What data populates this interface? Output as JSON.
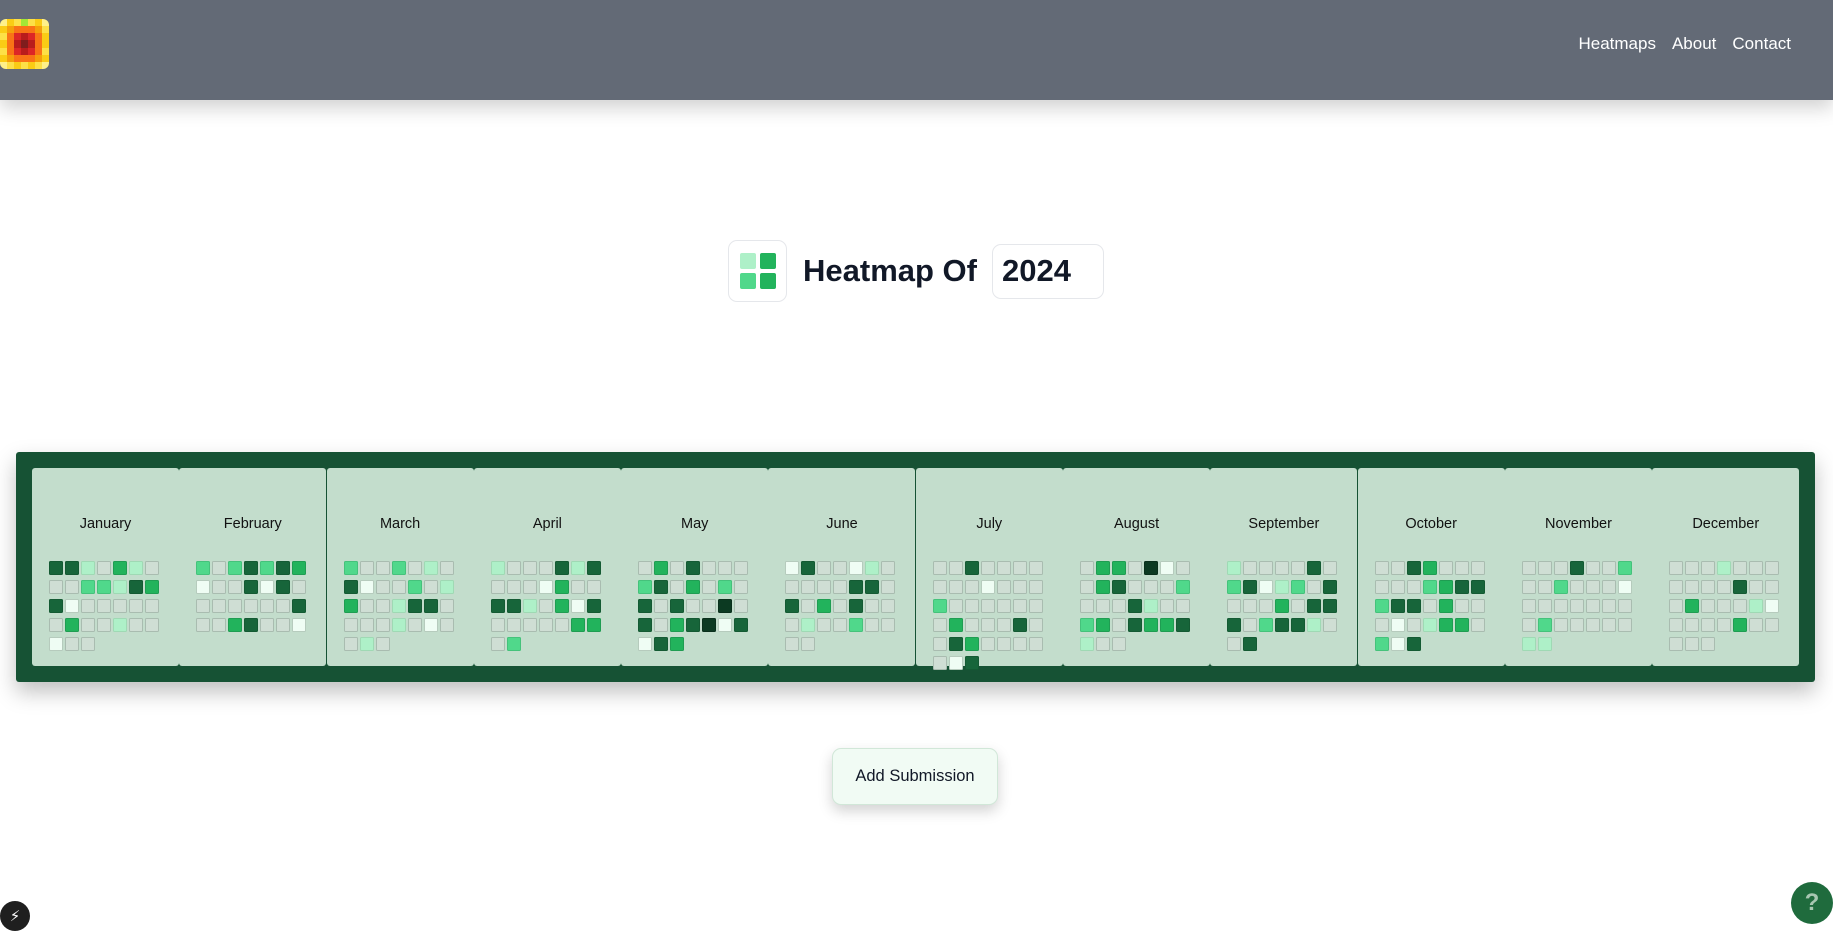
{
  "nav": {
    "logo_alt": "heatmap-logo",
    "links": [
      "Heatmaps",
      "About",
      "Contact"
    ]
  },
  "title": {
    "text": "Heatmap Of",
    "year": "2024"
  },
  "palette": [
    "#cfded4",
    "#effdf4",
    "#aef0c8",
    "#50d88b",
    "#22b35c",
    "#17653a",
    "#0c3a22"
  ],
  "logo_colors": {
    "grid": [
      [
        "#fef08a",
        "#facc15",
        "#fde047",
        "#a3e635",
        "#fde047",
        "#facc15",
        "#fef08a"
      ],
      [
        "#facc15",
        "#f59e0b",
        "#f97316",
        "#f97316",
        "#f97316",
        "#f59e0b",
        "#fde047"
      ],
      [
        "#fde047",
        "#f97316",
        "#dc2626",
        "#b91c1c",
        "#dc2626",
        "#f97316",
        "#facc15"
      ],
      [
        "#facc15",
        "#f97316",
        "#b91c1c",
        "#7f1d1d",
        "#b91c1c",
        "#f97316",
        "#facc15"
      ],
      [
        "#fde047",
        "#f97316",
        "#dc2626",
        "#b91c1c",
        "#dc2626",
        "#f97316",
        "#fde047"
      ],
      [
        "#facc15",
        "#f59e0b",
        "#f97316",
        "#f97316",
        "#f97316",
        "#f59e0b",
        "#facc15"
      ],
      [
        "#fef08a",
        "#fde047",
        "#facc15",
        "#fde047",
        "#facc15",
        "#fde047",
        "#fef08a"
      ]
    ]
  },
  "months": [
    {
      "name": "January",
      "offset": 0,
      "levels": [
        5,
        5,
        2,
        0,
        4,
        2,
        0,
        0,
        0,
        3,
        3,
        2,
        5,
        4,
        5,
        1,
        0,
        0,
        0,
        0,
        0,
        0,
        4,
        0,
        0,
        2,
        0,
        0,
        1,
        0,
        0
      ]
    },
    {
      "name": "February",
      "offset": 0,
      "levels": [
        3,
        0,
        3,
        5,
        3,
        5,
        4,
        1,
        0,
        0,
        5,
        1,
        5,
        0,
        0,
        0,
        0,
        0,
        0,
        0,
        5,
        0,
        0,
        4,
        5,
        0,
        0,
        1
      ]
    },
    {
      "name": "March",
      "offset": 0,
      "levels": [
        3,
        0,
        0,
        3,
        0,
        2,
        0,
        5,
        1,
        0,
        0,
        3,
        0,
        2,
        4,
        0,
        0,
        2,
        5,
        5,
        0,
        0,
        0,
        0,
        2,
        0,
        1,
        0,
        0,
        2,
        0
      ]
    },
    {
      "name": "April",
      "offset": 0,
      "levels": [
        2,
        0,
        0,
        0,
        5,
        2,
        5,
        0,
        0,
        0,
        1,
        4,
        0,
        0,
        5,
        5,
        2,
        0,
        4,
        1,
        5,
        0,
        0,
        0,
        0,
        0,
        4,
        4,
        0,
        3
      ]
    },
    {
      "name": "May",
      "offset": 0,
      "levels": [
        0,
        4,
        0,
        5,
        0,
        0,
        0,
        3,
        5,
        0,
        4,
        0,
        3,
        0,
        5,
        0,
        5,
        0,
        0,
        6,
        0,
        5,
        0,
        4,
        5,
        6,
        1,
        5,
        1,
        5,
        4
      ]
    },
    {
      "name": "June",
      "offset": 0,
      "levels": [
        1,
        5,
        0,
        0,
        1,
        2,
        0,
        0,
        0,
        0,
        0,
        5,
        5,
        0,
        5,
        0,
        4,
        0,
        5,
        0,
        0,
        0,
        2,
        0,
        0,
        3,
        0,
        0,
        0,
        0
      ]
    },
    {
      "name": "July",
      "offset": 0,
      "levels": [
        0,
        0,
        5,
        0,
        0,
        0,
        0,
        0,
        0,
        0,
        1,
        0,
        0,
        0,
        3,
        0,
        0,
        0,
        0,
        0,
        0,
        0,
        4,
        0,
        0,
        0,
        5,
        0,
        0,
        5,
        4,
        0,
        0,
        0,
        0,
        0,
        1,
        5
      ]
    },
    {
      "name": "August",
      "offset": 0,
      "levels": [
        0,
        4,
        4,
        0,
        6,
        1,
        0,
        0,
        4,
        5,
        0,
        0,
        0,
        3,
        0,
        0,
        0,
        5,
        2,
        0,
        0,
        3,
        4,
        0,
        5,
        4,
        4,
        5,
        2,
        0,
        0
      ]
    },
    {
      "name": "September",
      "offset": 0,
      "levels": [
        2,
        0,
        0,
        0,
        0,
        5,
        0,
        3,
        5,
        1,
        2,
        3,
        0,
        5,
        0,
        0,
        0,
        4,
        0,
        5,
        5,
        5,
        0,
        3,
        5,
        5,
        2,
        0,
        0,
        5
      ]
    },
    {
      "name": "October",
      "offset": 0,
      "levels": [
        0,
        0,
        5,
        4,
        0,
        0,
        0,
        0,
        0,
        0,
        3,
        4,
        5,
        5,
        3,
        5,
        5,
        0,
        4,
        0,
        0,
        0,
        1,
        0,
        2,
        4,
        4,
        0,
        3,
        1,
        5
      ]
    },
    {
      "name": "November",
      "offset": 0,
      "levels": [
        0,
        0,
        0,
        5,
        0,
        0,
        3,
        0,
        0,
        3,
        0,
        0,
        0,
        1,
        0,
        0,
        0,
        0,
        0,
        0,
        0,
        0,
        3,
        0,
        0,
        0,
        0,
        0,
        2,
        2
      ]
    },
    {
      "name": "December",
      "offset": 0,
      "levels": [
        0,
        0,
        0,
        2,
        0,
        0,
        0,
        0,
        0,
        0,
        0,
        5,
        0,
        0,
        0,
        4,
        0,
        0,
        0,
        2,
        1,
        0,
        0,
        0,
        0,
        4,
        0,
        0,
        0,
        0,
        0
      ]
    }
  ],
  "actions": {
    "add_label": "Add Submission"
  },
  "floating": {
    "bolt": "⚡",
    "help": "?"
  }
}
